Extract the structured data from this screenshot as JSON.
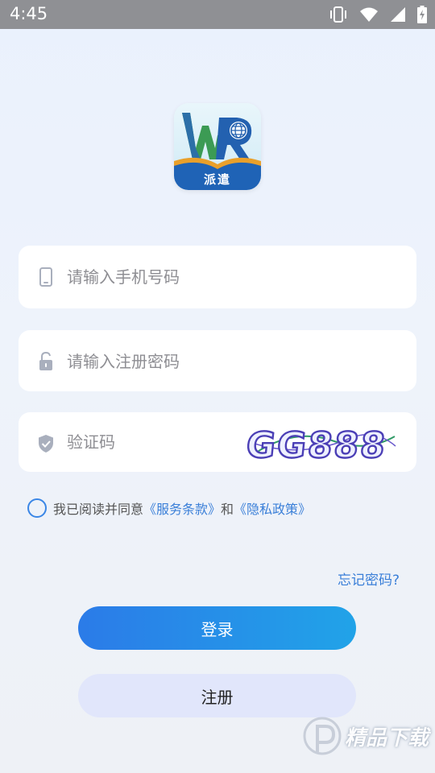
{
  "status_bar": {
    "time": "4:45",
    "icons": [
      "vibrate-icon",
      "wifi-icon",
      "signal-icon",
      "battery-icon"
    ]
  },
  "logo": {
    "text": "派遣",
    "letters": "WR"
  },
  "form": {
    "phone_placeholder": "请输入手机号码",
    "password_placeholder": "请输入注册密码",
    "code_placeholder": "验证码",
    "captcha_text": "GG888"
  },
  "agreement": {
    "prefix": "我已阅读并同意",
    "terms_link": "《服务条款》",
    "conjunction": "和",
    "privacy_link": "《隐私政策》"
  },
  "forgot_password": "忘记密码?",
  "buttons": {
    "login": "登录",
    "register": "注册"
  },
  "watermark": {
    "text": "精品下载"
  },
  "colors": {
    "accent": "#3a7fd8",
    "login_gradient_start": "#2b7be8",
    "login_gradient_end": "#21a3e8",
    "register_bg": "#e1e6fb",
    "status_bar_bg": "#8f9094"
  }
}
